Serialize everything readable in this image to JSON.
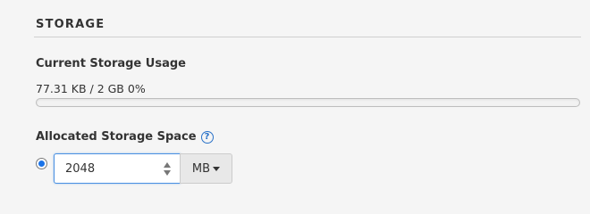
{
  "section": {
    "title": "STORAGE"
  },
  "usage": {
    "heading": "Current Storage Usage",
    "used": "77.31 KB / 2 GB",
    "percent_label": "0%",
    "percent_value": 0
  },
  "allocation": {
    "heading": "Allocated Storage Space",
    "help_glyph": "?",
    "radio_selected": true,
    "value": "2048",
    "unit": "MB"
  },
  "colors": {
    "accent": "#2a72c8",
    "background": "#f5f5f5"
  }
}
